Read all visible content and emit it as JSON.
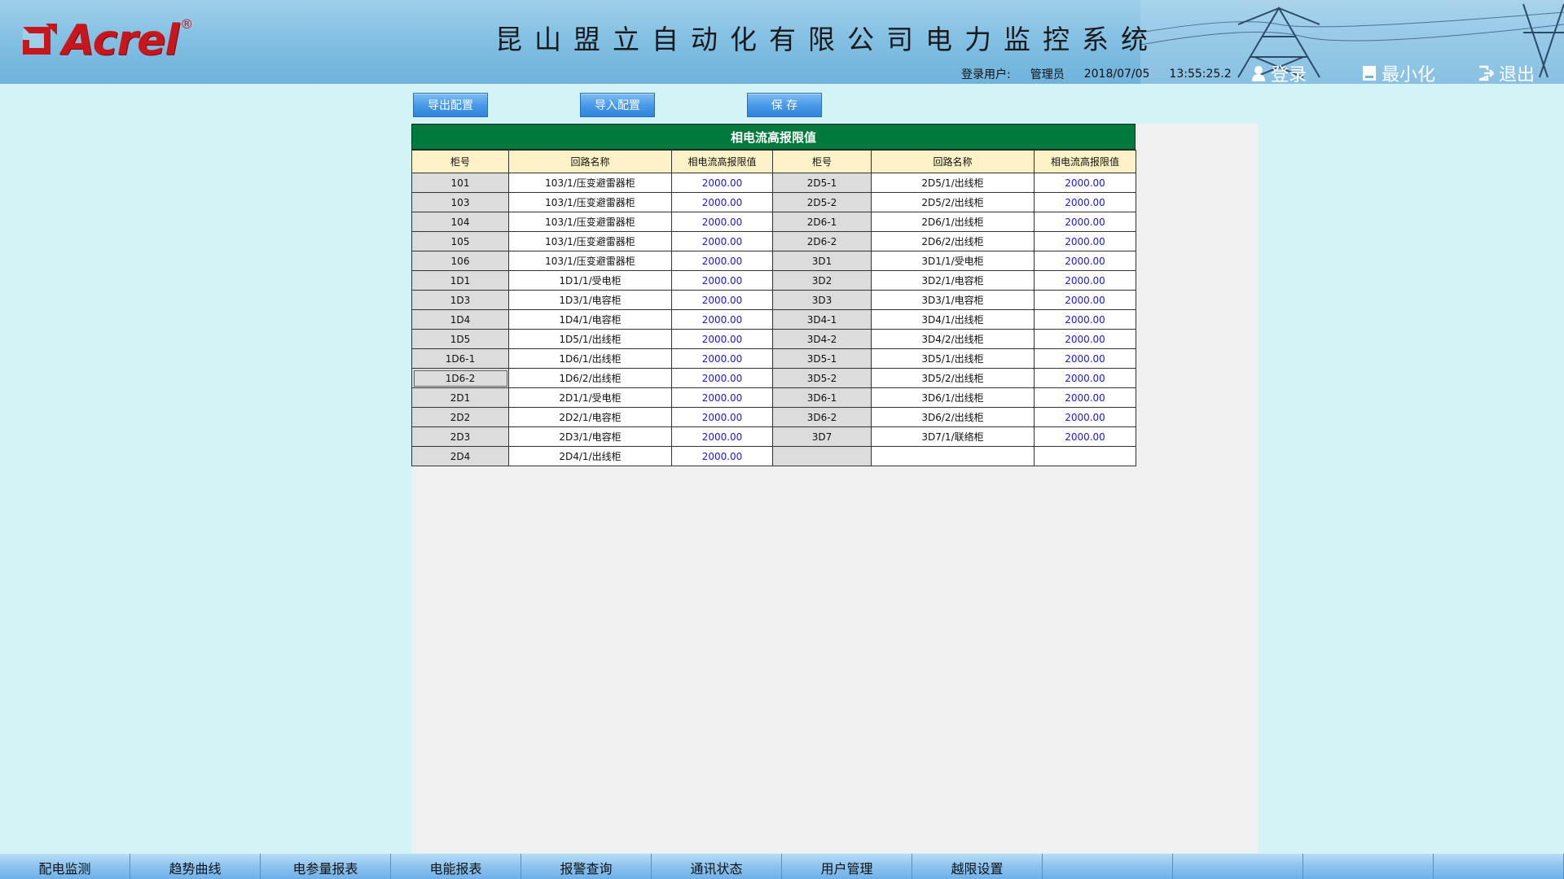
{
  "header": {
    "brand": "Acrel",
    "brand_mark": "®",
    "title": "昆山盟立自动化有限公司电力监控系统",
    "user_label": "登录用户:",
    "user": "管理员",
    "date": "2018/07/05",
    "time": "13:55:25.2",
    "login_label": "登录",
    "minimize_label": "最小化",
    "exit_label": "退出"
  },
  "toolbar": {
    "export_label": "导出配置",
    "import_label": "导入配置",
    "save_label": "保 存"
  },
  "table": {
    "title": "相电流高报限值",
    "columns": [
      "柜号",
      "回路名称",
      "相电流高报限值",
      "柜号",
      "回路名称",
      "相电流高报限值"
    ],
    "rows": [
      {
        "id1": "101",
        "name1": "103/1/压变避雷器柜",
        "val1": "2000.00",
        "id2": "2D5-1",
        "name2": "2D5/1/出线柜",
        "val2": "2000.00"
      },
      {
        "id1": "103",
        "name1": "103/1/压变避雷器柜",
        "val1": "2000.00",
        "id2": "2D5-2",
        "name2": "2D5/2/出线柜",
        "val2": "2000.00"
      },
      {
        "id1": "104",
        "name1": "103/1/压变避雷器柜",
        "val1": "2000.00",
        "id2": "2D6-1",
        "name2": "2D6/1/出线柜",
        "val2": "2000.00"
      },
      {
        "id1": "105",
        "name1": "103/1/压变避雷器柜",
        "val1": "2000.00",
        "id2": "2D6-2",
        "name2": "2D6/2/出线柜",
        "val2": "2000.00"
      },
      {
        "id1": "106",
        "name1": "103/1/压变避雷器柜",
        "val1": "2000.00",
        "id2": "3D1",
        "name2": "3D1/1/受电柜",
        "val2": "2000.00"
      },
      {
        "id1": "1D1",
        "name1": "1D1/1/受电柜",
        "val1": "2000.00",
        "id2": "3D2",
        "name2": "3D2/1/电容柜",
        "val2": "2000.00"
      },
      {
        "id1": "1D3",
        "name1": "1D3/1/电容柜",
        "val1": "2000.00",
        "id2": "3D3",
        "name2": "3D3/1/电容柜",
        "val2": "2000.00"
      },
      {
        "id1": "1D4",
        "name1": "1D4/1/电容柜",
        "val1": "2000.00",
        "id2": "3D4-1",
        "name2": "3D4/1/出线柜",
        "val2": "2000.00"
      },
      {
        "id1": "1D5",
        "name1": "1D5/1/出线柜",
        "val1": "2000.00",
        "id2": "3D4-2",
        "name2": "3D4/2/出线柜",
        "val2": "2000.00"
      },
      {
        "id1": "1D6-1",
        "name1": "1D6/1/出线柜",
        "val1": "2000.00",
        "id2": "3D5-1",
        "name2": "3D5/1/出线柜",
        "val2": "2000.00"
      },
      {
        "id1": "1D6-2",
        "name1": "1D6/2/出线柜",
        "val1": "2000.00",
        "id2": "3D5-2",
        "name2": "3D5/2/出线柜",
        "val2": "2000.00"
      },
      {
        "id1": "2D1",
        "name1": "2D1/1/受电柜",
        "val1": "2000.00",
        "id2": "3D6-1",
        "name2": "3D6/1/出线柜",
        "val2": "2000.00"
      },
      {
        "id1": "2D2",
        "name1": "2D2/1/电容柜",
        "val1": "2000.00",
        "id2": "3D6-2",
        "name2": "3D6/2/出线柜",
        "val2": "2000.00"
      },
      {
        "id1": "2D3",
        "name1": "2D3/1/电容柜",
        "val1": "2000.00",
        "id2": "3D7",
        "name2": "3D7/1/联络柜",
        "val2": "2000.00"
      },
      {
        "id1": "2D4",
        "name1": "2D4/1/出线柜",
        "val1": "2000.00",
        "id2": "",
        "name2": "",
        "val2": ""
      }
    ],
    "selected_cell": "1D6-2"
  },
  "bottom_nav": [
    "配电监测",
    "趋势曲线",
    "电参量报表",
    "电能报表",
    "报警查询",
    "通讯状态",
    "用户管理",
    "越限设置",
    "",
    "",
    "",
    ""
  ],
  "colors": {
    "title_bar": "#007a3c",
    "header_cell": "#fdf2c6",
    "id_cell": "#dcdcdc",
    "value_text": "#1a1acc",
    "brand_red": "#c8161d"
  }
}
